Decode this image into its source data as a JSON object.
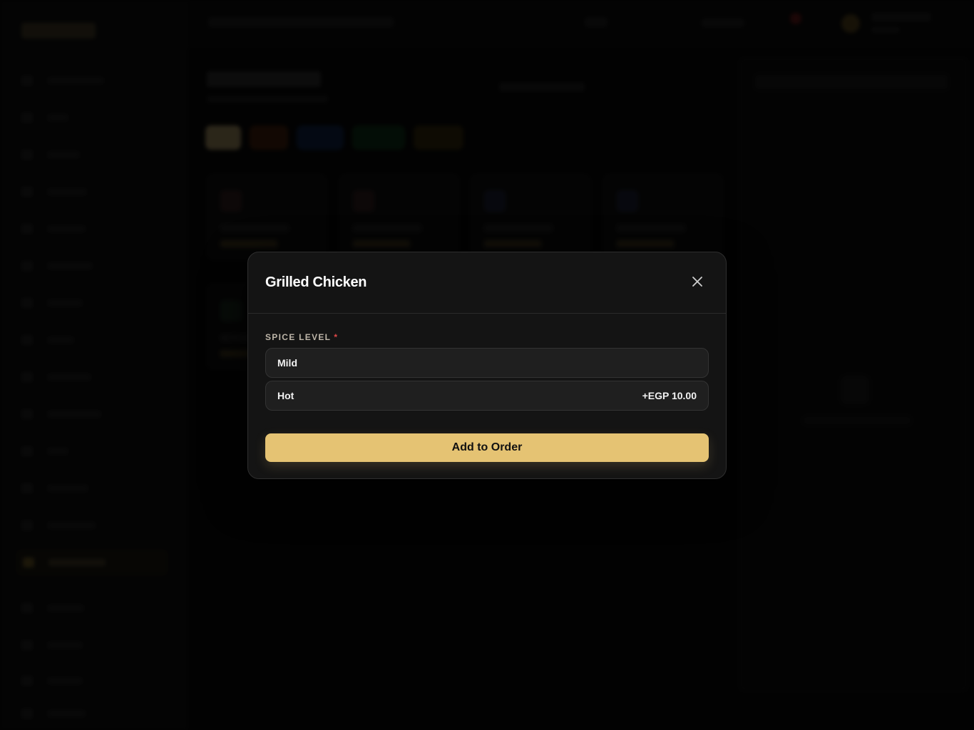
{
  "modal": {
    "title": "Grilled Chicken",
    "close_icon": "close-icon",
    "modifier_group": {
      "label": "SPICE LEVEL",
      "required_marker": "*",
      "options": [
        {
          "name": "Mild",
          "price": ""
        },
        {
          "name": "Hot",
          "price": "+EGP 10.00"
        }
      ]
    },
    "add_button_label": "Add to Order"
  },
  "colors": {
    "accent": "#e5c373",
    "required": "#e04848",
    "modal_bg": "#141414",
    "option_bg": "#1f1f1f"
  }
}
